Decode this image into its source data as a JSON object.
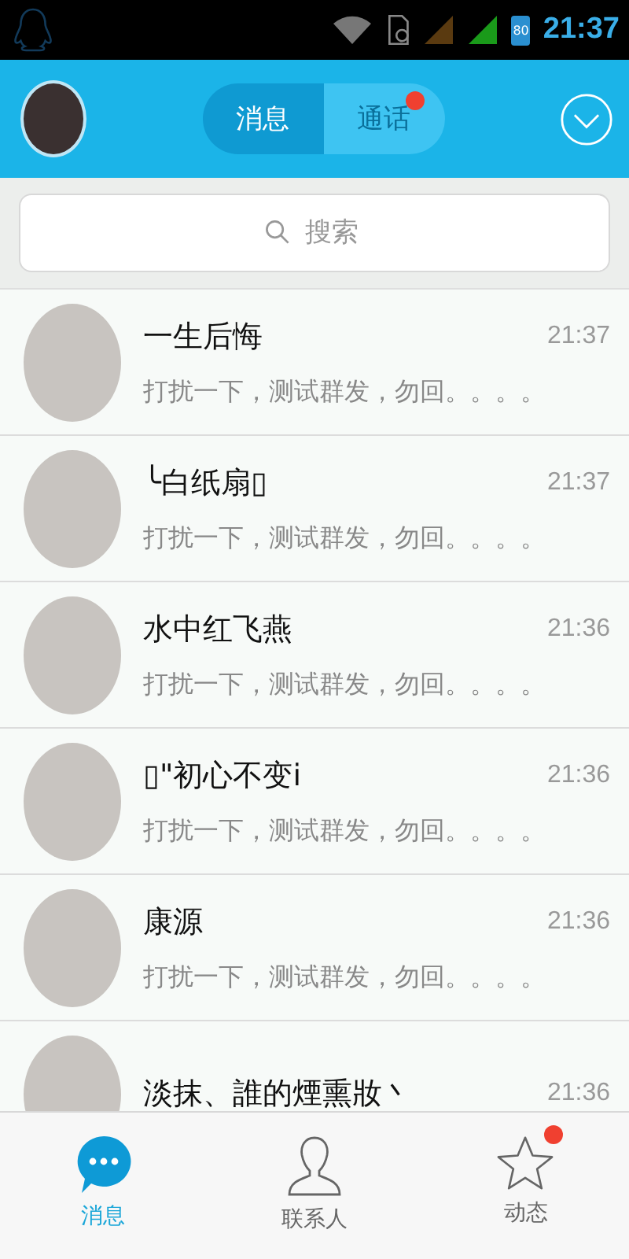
{
  "status_bar": {
    "battery": "80",
    "time": "21:37"
  },
  "header": {
    "tabs": [
      {
        "label": "消息",
        "selected": true,
        "badge": false
      },
      {
        "label": "通话",
        "selected": false,
        "badge": true
      }
    ]
  },
  "search": {
    "placeholder": "搜索"
  },
  "conversations": [
    {
      "name": "一生后悔",
      "time": "21:37",
      "preview": "打扰一下，测试群发，勿回。。。。"
    },
    {
      "name": "╰白纸扇▯",
      "time": "21:37",
      "preview": "打扰一下，测试群发，勿回。。。。"
    },
    {
      "name": "水中红飞燕",
      "time": "21:36",
      "preview": "打扰一下，测试群发，勿回。。。。"
    },
    {
      "name": "▯\"初心不变i",
      "time": "21:36",
      "preview": "打扰一下，测试群发，勿回。。。。"
    },
    {
      "name": "康源",
      "time": "21:36",
      "preview": "打扰一下，测试群发，勿回。。。。"
    },
    {
      "name": "淡抹、誰的煙熏妝丶",
      "time": "21:36"
    }
  ],
  "bottom_nav": [
    {
      "label": "消息",
      "kind": "messages",
      "selected": true,
      "badge": false
    },
    {
      "label": "联系人",
      "kind": "contacts",
      "selected": false,
      "badge": false
    },
    {
      "label": "动态",
      "kind": "feed",
      "selected": false,
      "badge": true
    }
  ]
}
